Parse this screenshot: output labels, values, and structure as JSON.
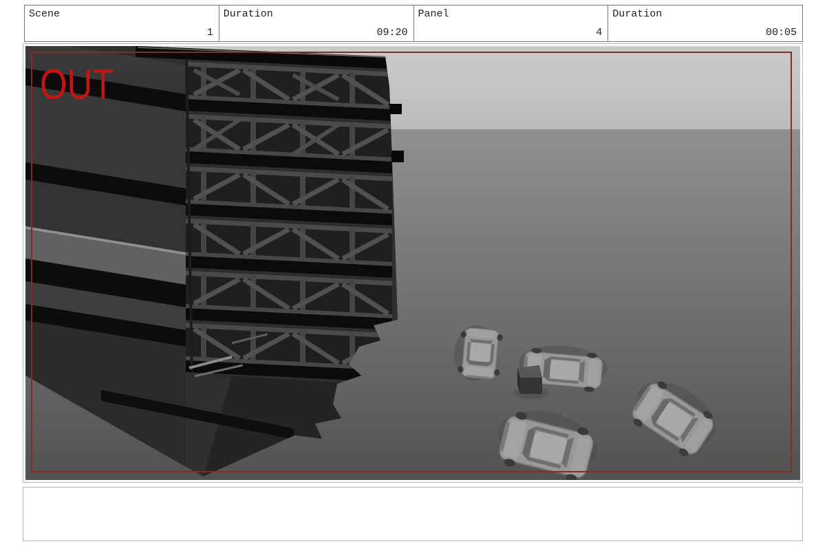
{
  "header": {
    "cells": [
      {
        "label": "Scene",
        "value": "1"
      },
      {
        "label": "Duration",
        "value": "09:20"
      },
      {
        "label": "Panel",
        "value": "4"
      },
      {
        "label": "Duration",
        "value": "00:05"
      }
    ]
  },
  "panel": {
    "out_label": "OUT"
  },
  "caption": {
    "text": ""
  },
  "scene": {
    "objects": [
      "ruined-building",
      "sedan-car",
      "sedan-car",
      "sedan-car",
      "sedan-car",
      "street-box"
    ]
  },
  "colors": {
    "marker": "#c41512",
    "frame": "#7d2f28",
    "sky_top": "#cacaca",
    "sky_bottom": "#bbbbbb",
    "ground_top": "#909090",
    "ground_bottom": "#525252",
    "building_base": "#2f2f2f",
    "building_face": "#3a3a3a",
    "slab_black": "#0b0b0b",
    "truss_gray": "#515151",
    "car_body": "#989898"
  }
}
